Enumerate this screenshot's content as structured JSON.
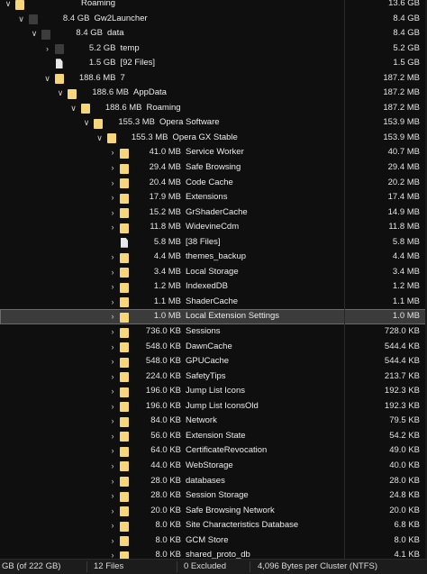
{
  "rows": [
    {
      "size": "13.6 GB",
      "name": "Roaming",
      "alloc": "13.6 GB",
      "level": 0,
      "icon": "folder",
      "chevron": "open",
      "sizeHidden": true
    },
    {
      "size": "8.4 GB",
      "name": "Gw2Launcher",
      "alloc": "8.4 GB",
      "level": 1,
      "icon": "folder-gray",
      "chevron": "open"
    },
    {
      "size": "8.4 GB",
      "name": "data",
      "alloc": "8.4 GB",
      "level": 2,
      "icon": "folder-gray",
      "chevron": "open"
    },
    {
      "size": "5.2 GB",
      "name": "temp",
      "alloc": "5.2 GB",
      "level": 3,
      "icon": "folder-gray",
      "chevron": "closed"
    },
    {
      "size": "1.5 GB",
      "name": "[92 Files]",
      "alloc": "1.5 GB",
      "level": 3,
      "icon": "file",
      "chevron": "none"
    },
    {
      "size": "188.6 MB",
      "name": "7",
      "alloc": "187.2 MB",
      "level": 3,
      "icon": "folder",
      "chevron": "open"
    },
    {
      "size": "188.6 MB",
      "name": "AppData",
      "alloc": "187.2 MB",
      "level": 4,
      "icon": "folder",
      "chevron": "open"
    },
    {
      "size": "188.6 MB",
      "name": "Roaming",
      "alloc": "187.2 MB",
      "level": 5,
      "icon": "folder",
      "chevron": "open"
    },
    {
      "size": "155.3 MB",
      "name": "Opera Software",
      "alloc": "153.9 MB",
      "level": 6,
      "icon": "folder",
      "chevron": "open"
    },
    {
      "size": "155.3 MB",
      "name": "Opera GX Stable",
      "alloc": "153.9 MB",
      "level": 7,
      "icon": "folder",
      "chevron": "open"
    },
    {
      "size": "41.0 MB",
      "name": "Service Worker",
      "alloc": "40.7 MB",
      "level": 8,
      "icon": "folder",
      "chevron": "closed"
    },
    {
      "size": "29.4 MB",
      "name": "Safe Browsing",
      "alloc": "29.4 MB",
      "level": 8,
      "icon": "folder",
      "chevron": "closed"
    },
    {
      "size": "20.4 MB",
      "name": "Code Cache",
      "alloc": "20.2 MB",
      "level": 8,
      "icon": "folder",
      "chevron": "closed"
    },
    {
      "size": "17.9 MB",
      "name": "Extensions",
      "alloc": "17.4 MB",
      "level": 8,
      "icon": "folder",
      "chevron": "closed"
    },
    {
      "size": "15.2 MB",
      "name": "GrShaderCache",
      "alloc": "14.9 MB",
      "level": 8,
      "icon": "folder",
      "chevron": "closed"
    },
    {
      "size": "11.8 MB",
      "name": "WidevineCdm",
      "alloc": "11.8 MB",
      "level": 8,
      "icon": "folder",
      "chevron": "closed"
    },
    {
      "size": "5.8 MB",
      "name": "[38 Files]",
      "alloc": "5.8 MB",
      "level": 8,
      "icon": "file",
      "chevron": "none"
    },
    {
      "size": "4.4 MB",
      "name": "themes_backup",
      "alloc": "4.4 MB",
      "level": 8,
      "icon": "folder",
      "chevron": "closed"
    },
    {
      "size": "3.4 MB",
      "name": "Local Storage",
      "alloc": "3.4 MB",
      "level": 8,
      "icon": "folder",
      "chevron": "closed"
    },
    {
      "size": "1.2 MB",
      "name": "IndexedDB",
      "alloc": "1.2 MB",
      "level": 8,
      "icon": "folder",
      "chevron": "closed"
    },
    {
      "size": "1.1 MB",
      "name": "ShaderCache",
      "alloc": "1.1 MB",
      "level": 8,
      "icon": "folder",
      "chevron": "closed"
    },
    {
      "size": "1.0 MB",
      "name": "Local Extension Settings",
      "alloc": "1.0 MB",
      "level": 8,
      "icon": "folder",
      "chevron": "closed",
      "selected": true
    },
    {
      "size": "736.0 KB",
      "name": "Sessions",
      "alloc": "728.0 KB",
      "level": 8,
      "icon": "folder",
      "chevron": "closed"
    },
    {
      "size": "548.0 KB",
      "name": "DawnCache",
      "alloc": "544.4 KB",
      "level": 8,
      "icon": "folder",
      "chevron": "closed"
    },
    {
      "size": "548.0 KB",
      "name": "GPUCache",
      "alloc": "544.4 KB",
      "level": 8,
      "icon": "folder",
      "chevron": "closed"
    },
    {
      "size": "224.0 KB",
      "name": "SafetyTips",
      "alloc": "213.7 KB",
      "level": 8,
      "icon": "folder",
      "chevron": "closed"
    },
    {
      "size": "196.0 KB",
      "name": "Jump List Icons",
      "alloc": "192.3 KB",
      "level": 8,
      "icon": "folder",
      "chevron": "closed"
    },
    {
      "size": "196.0 KB",
      "name": "Jump List IconsOld",
      "alloc": "192.3 KB",
      "level": 8,
      "icon": "folder",
      "chevron": "closed"
    },
    {
      "size": "84.0 KB",
      "name": "Network",
      "alloc": "79.5 KB",
      "level": 8,
      "icon": "folder",
      "chevron": "closed"
    },
    {
      "size": "56.0 KB",
      "name": "Extension State",
      "alloc": "54.2 KB",
      "level": 8,
      "icon": "folder",
      "chevron": "closed"
    },
    {
      "size": "64.0 KB",
      "name": "CertificateRevocation",
      "alloc": "49.0 KB",
      "level": 8,
      "icon": "folder",
      "chevron": "closed"
    },
    {
      "size": "44.0 KB",
      "name": "WebStorage",
      "alloc": "40.0 KB",
      "level": 8,
      "icon": "folder",
      "chevron": "closed"
    },
    {
      "size": "28.0 KB",
      "name": "databases",
      "alloc": "28.0 KB",
      "level": 8,
      "icon": "folder",
      "chevron": "closed"
    },
    {
      "size": "28.0 KB",
      "name": "Session Storage",
      "alloc": "24.8 KB",
      "level": 8,
      "icon": "folder",
      "chevron": "closed"
    },
    {
      "size": "20.0 KB",
      "name": "Safe Browsing Network",
      "alloc": "20.0 KB",
      "level": 8,
      "icon": "folder",
      "chevron": "closed"
    },
    {
      "size": "8.0 KB",
      "name": "Site Characteristics Database",
      "alloc": "6.8 KB",
      "level": 8,
      "icon": "folder",
      "chevron": "closed"
    },
    {
      "size": "8.0 KB",
      "name": "GCM Store",
      "alloc": "8.0 KB",
      "level": 8,
      "icon": "folder",
      "chevron": "closed"
    },
    {
      "size": "8.0 KB",
      "name": "shared_proto_db",
      "alloc": "4.1 KB",
      "level": 8,
      "icon": "folder",
      "chevron": "closed"
    }
  ],
  "status": {
    "disk": "GB  (of 222 GB)",
    "files": "12 Files",
    "excluded": "0 Excluded",
    "cluster": "4,096 Bytes per Cluster (NTFS)"
  },
  "colors": {
    "folder": "#f5d67b",
    "background": "#0f0f0f",
    "selection": "#3b3b3b"
  }
}
